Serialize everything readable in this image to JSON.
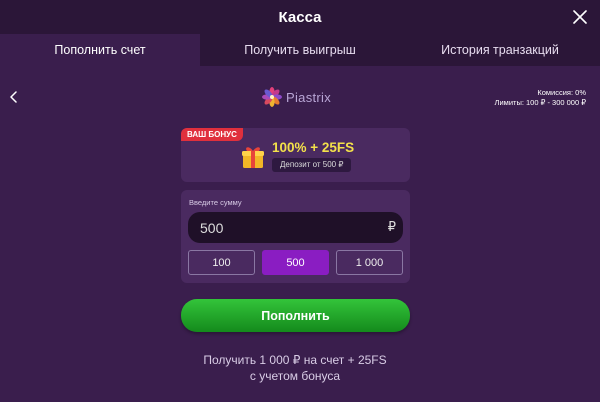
{
  "header": {
    "title": "Касса"
  },
  "tabs": [
    {
      "label": "Пополнить счет",
      "active": true
    },
    {
      "label": "Получить выигрыш",
      "active": false
    },
    {
      "label": "История транзакций",
      "active": false
    }
  ],
  "payment": {
    "provider_name": "Piastrix",
    "commission": "Комиссия: 0%",
    "limits": "Лимиты: 100 ₽ - 300 000 ₽"
  },
  "bonus": {
    "tag": "ВАШ БОНУС",
    "title": "100% + 25FS",
    "deposit_note": "Депозит от 500 ₽",
    "icon": "gift-icon"
  },
  "amount": {
    "label": "Введите сумму",
    "value": "500",
    "currency": "₽",
    "presets": [
      "100",
      "500",
      "1 000"
    ],
    "selected_preset": "500"
  },
  "submit_label": "Пополнить",
  "summary_line1": "Получить 1 000 ₽ на счет + 25FS",
  "summary_line2": "с учетом бонуса",
  "colors": {
    "background": "#3a1e4d",
    "header": "#2b1638",
    "card": "#4a2a60",
    "bonus_title": "#f3e14a",
    "bonus_tag": "#e0303d",
    "selected_preset": "#8a1dc2",
    "submit_button": "#22a52b"
  }
}
